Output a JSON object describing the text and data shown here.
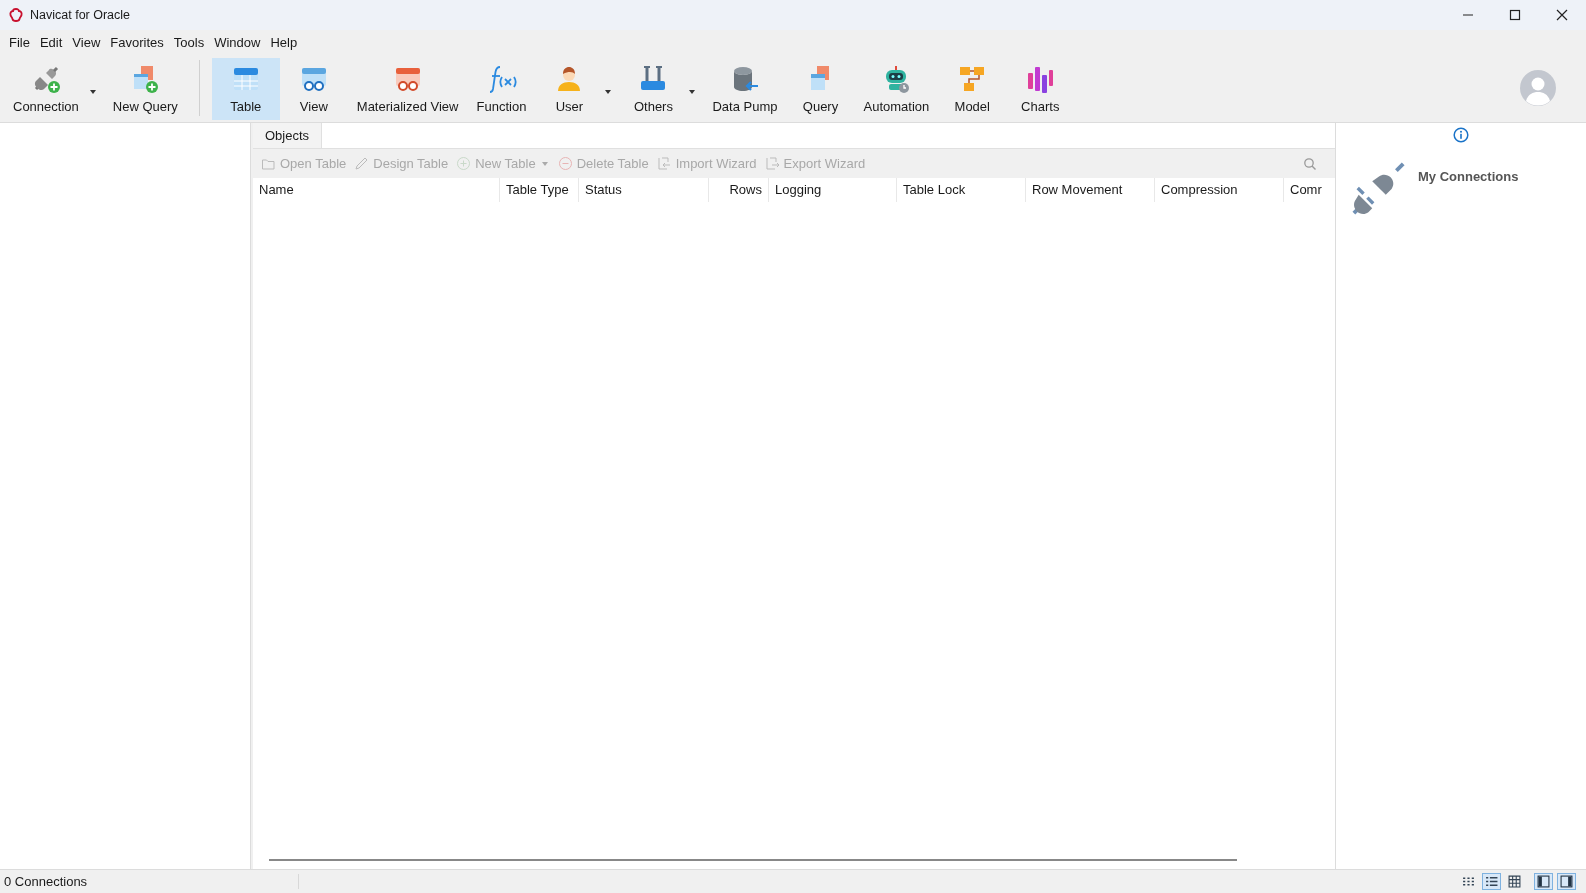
{
  "window": {
    "title": "Navicat for Oracle"
  },
  "menu": [
    "File",
    "Edit",
    "View",
    "Favorites",
    "Tools",
    "Window",
    "Help"
  ],
  "toolbar": [
    {
      "label": "Connection",
      "selected": false,
      "dropdown": true
    },
    {
      "label": "New Query",
      "selected": false,
      "dropdown": false
    },
    {
      "label": "Table",
      "selected": true,
      "dropdown": false
    },
    {
      "label": "View",
      "selected": false,
      "dropdown": false
    },
    {
      "label": "Materialized View",
      "selected": false,
      "dropdown": false
    },
    {
      "label": "Function",
      "selected": false,
      "dropdown": false
    },
    {
      "label": "User",
      "selected": false,
      "dropdown": true
    },
    {
      "label": "Others",
      "selected": false,
      "dropdown": true
    },
    {
      "label": "Data Pump",
      "selected": false,
      "dropdown": false
    },
    {
      "label": "Query",
      "selected": false,
      "dropdown": false
    },
    {
      "label": "Automation",
      "selected": false,
      "dropdown": false
    },
    {
      "label": "Model",
      "selected": false,
      "dropdown": false
    },
    {
      "label": "Charts",
      "selected": false,
      "dropdown": false
    }
  ],
  "tabs": [
    {
      "label": "Objects",
      "selected": true
    }
  ],
  "object_toolbar": [
    {
      "label": "Open Table",
      "disabled": true,
      "dropdown": false
    },
    {
      "label": "Design Table",
      "disabled": true,
      "dropdown": false
    },
    {
      "label": "New Table",
      "disabled": true,
      "dropdown": true
    },
    {
      "label": "Delete Table",
      "disabled": true,
      "dropdown": false
    },
    {
      "label": "Import Wizard",
      "disabled": true,
      "dropdown": false
    },
    {
      "label": "Export Wizard",
      "disabled": true,
      "dropdown": false
    }
  ],
  "table": {
    "columns": [
      {
        "label": "Name"
      },
      {
        "label": "Table Type"
      },
      {
        "label": "Status"
      },
      {
        "label": "Rows"
      },
      {
        "label": "Logging"
      },
      {
        "label": "Table Lock"
      },
      {
        "label": "Row Movement"
      },
      {
        "label": "Compression"
      },
      {
        "label": "Comr"
      }
    ]
  },
  "info_panel": {
    "title": "My Connections"
  },
  "status_bar": {
    "text": "0 Connections",
    "view_modes": [
      {
        "selected": false
      },
      {
        "selected": true
      },
      {
        "selected": false
      }
    ],
    "panels": [
      {
        "on": true
      },
      {
        "on": true
      }
    ]
  }
}
